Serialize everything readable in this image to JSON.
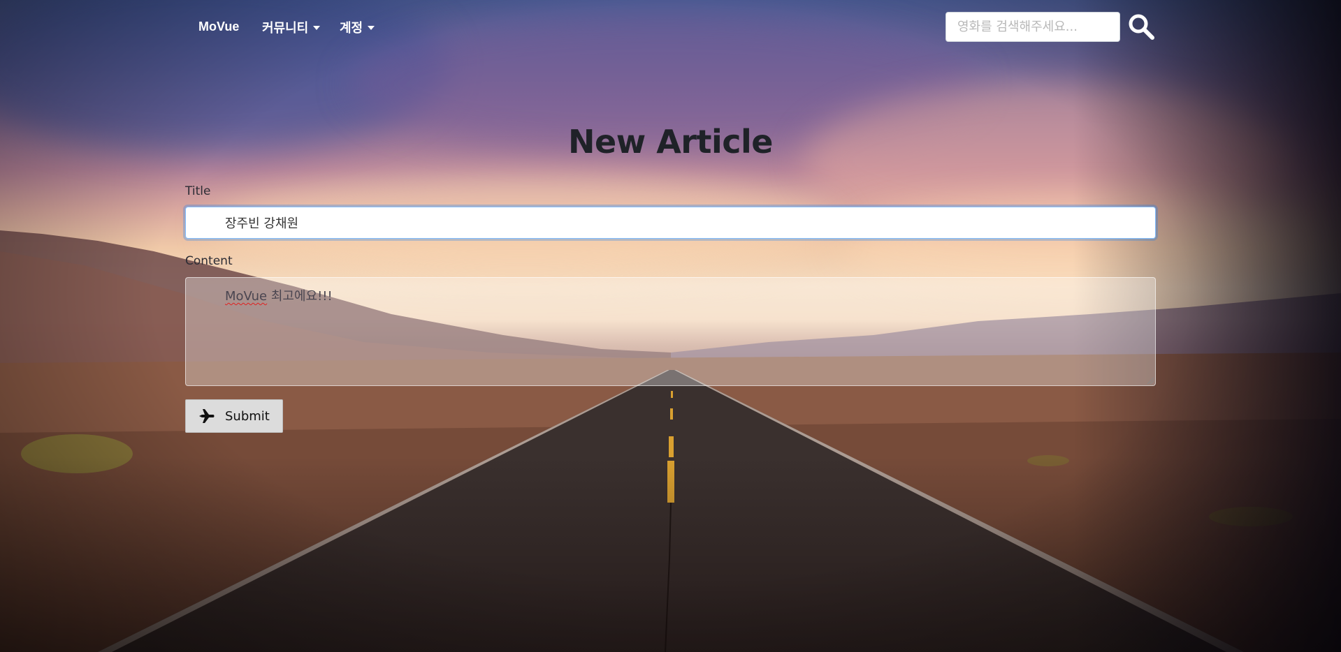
{
  "navbar": {
    "brand": "MoVue",
    "community_label": "커뮤니티",
    "account_label": "계정",
    "search_placeholder": "영화를 검색해주세요..."
  },
  "page": {
    "title": "New Article"
  },
  "form": {
    "title_label": "Title",
    "title_value": "장주빈 강채원",
    "content_label": "Content",
    "content_word_misspelled": "MoVue",
    "content_rest": " 최고에요!!!",
    "submit_label": "Submit"
  },
  "icons": {
    "search": "search-icon",
    "submit": "airplane-icon",
    "caret": "caret-down-icon"
  },
  "colors": {
    "title_text": "#1f2228",
    "focus_border": "#80bdff",
    "submit_bg": "#dcdcdc"
  }
}
